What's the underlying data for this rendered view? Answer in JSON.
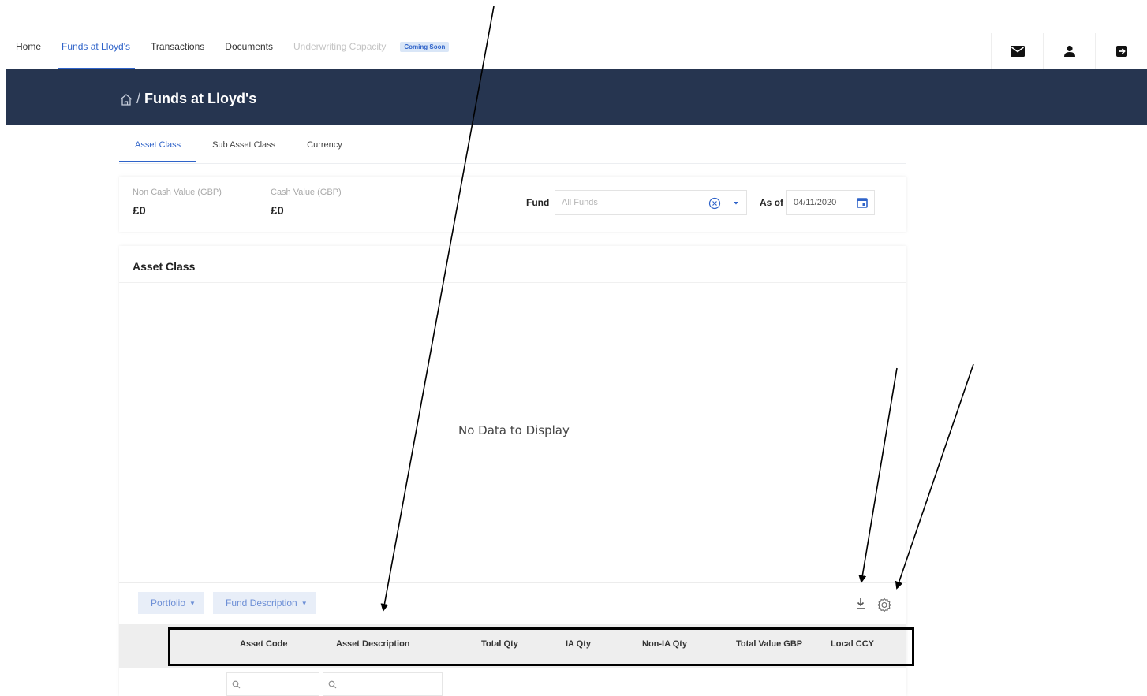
{
  "nav": {
    "links": [
      {
        "label": "Home"
      },
      {
        "label": "Funds at Lloyd's"
      },
      {
        "label": "Transactions"
      },
      {
        "label": "Documents"
      },
      {
        "label": "Underwriting Capacity"
      }
    ],
    "badge": "Coming Soon",
    "icons": [
      "mail-icon",
      "user-icon",
      "logout-icon"
    ]
  },
  "banner": {
    "separator": "/",
    "title": "Funds at Lloyd's"
  },
  "tabs": [
    {
      "label": "Asset Class"
    },
    {
      "label": "Sub Asset Class"
    },
    {
      "label": "Currency"
    }
  ],
  "summary": {
    "non_cash_label": "Non Cash Value (GBP)",
    "non_cash_value": "£0",
    "cash_label": "Cash Value (GBP)",
    "cash_value": "£0",
    "fund_label": "Fund",
    "fund_placeholder": "All Funds",
    "asof_label": "As of",
    "asof_value": "04/11/2020"
  },
  "asset_card": {
    "title": "Asset Class",
    "empty_message": "No Data to Display",
    "chips": [
      "Portfolio",
      "Fund Description"
    ],
    "columns": [
      "Asset Code",
      "Asset Description",
      "Total Qty",
      "IA Qty",
      "Non-IA Qty",
      "Total Value GBP",
      "Local CCY"
    ]
  },
  "colors": {
    "accent": "#2f63c9",
    "banner": "#263550",
    "chip_bg": "#e8eef8"
  }
}
